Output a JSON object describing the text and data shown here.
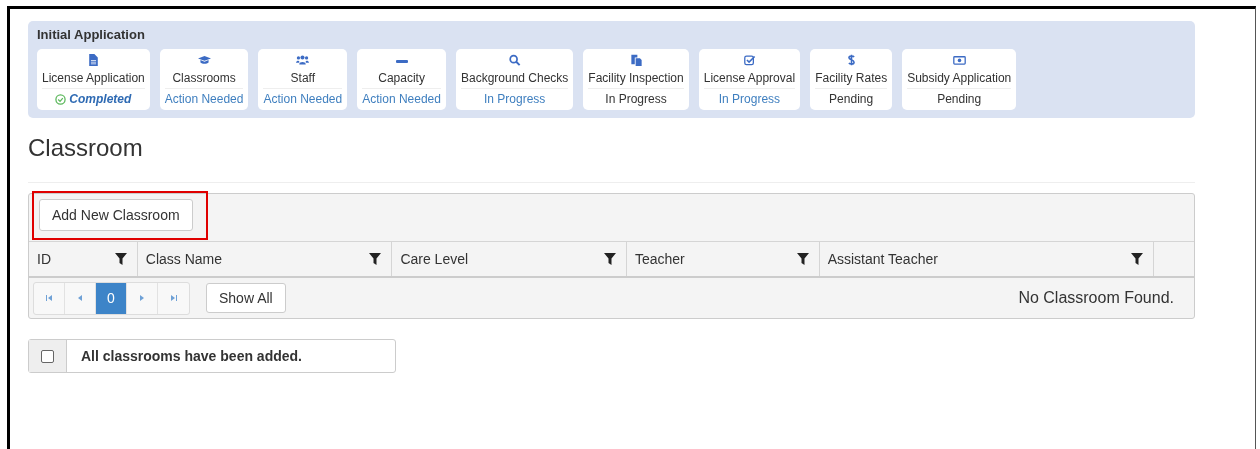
{
  "steps_panel": {
    "title": "Initial Application",
    "steps": [
      {
        "label": "License Application",
        "status": "Completed",
        "kind": "completed"
      },
      {
        "label": "Classrooms",
        "status": "Action Needed",
        "kind": "active"
      },
      {
        "label": "Staff",
        "status": "Action Needed",
        "kind": "active"
      },
      {
        "label": "Capacity",
        "status": "Action Needed",
        "kind": "active"
      },
      {
        "label": "Background Checks",
        "status": "In Progress",
        "kind": "active"
      },
      {
        "label": "Facility Inspection",
        "status": "In Progress",
        "kind": "plain"
      },
      {
        "label": "License Approval",
        "status": "In Progress",
        "kind": "active"
      },
      {
        "label": "Facility Rates",
        "status": "Pending",
        "kind": "plain"
      },
      {
        "label": "Subsidy Application",
        "status": "Pending",
        "kind": "plain"
      }
    ]
  },
  "heading": "Classroom",
  "grid": {
    "add_button": {
      "label": "Add New Classroom",
      "highlighted": true
    },
    "columns": [
      "ID",
      "Class Name",
      "Care Level",
      "Teacher",
      "Assistant Teacher"
    ],
    "pager": {
      "pages": [
        {
          "label": "0",
          "selected": true
        }
      ],
      "show_all": "Show All"
    },
    "empty_message": "No Classroom Found."
  },
  "confirmation": {
    "label": "All classrooms have been added.",
    "checked": false
  }
}
